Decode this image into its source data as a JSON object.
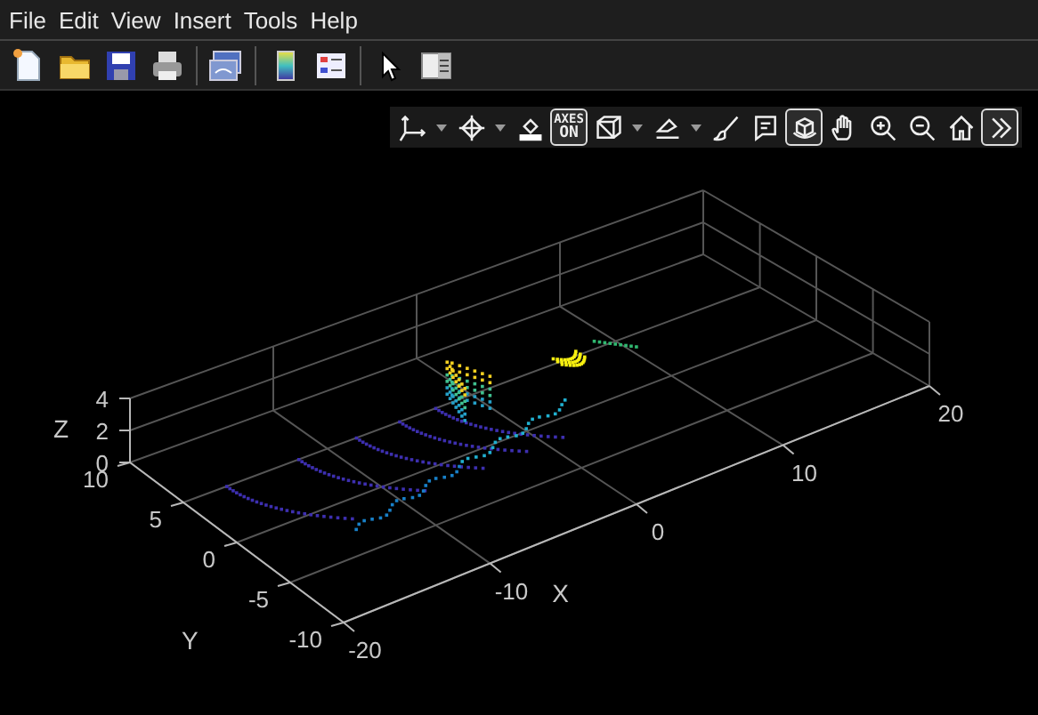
{
  "menu": [
    "File",
    "Edit",
    "View",
    "Insert",
    "Tools",
    "Help"
  ],
  "toolbar": [
    {
      "kind": "new"
    },
    {
      "kind": "open"
    },
    {
      "kind": "save"
    },
    {
      "kind": "print"
    },
    {
      "kind": "sep"
    },
    {
      "kind": "link"
    },
    {
      "kind": "sep"
    },
    {
      "kind": "colorbar"
    },
    {
      "kind": "legend"
    },
    {
      "kind": "sep"
    },
    {
      "kind": "pointer"
    },
    {
      "kind": "panel"
    }
  ],
  "axes_toolbar": [
    {
      "kind": "axes",
      "selected": false
    },
    {
      "kind": "caret"
    },
    {
      "kind": "cursor",
      "selected": false
    },
    {
      "kind": "caret"
    },
    {
      "kind": "fill",
      "selected": false
    },
    {
      "kind": "label",
      "label": "AXES",
      "label2": "ON",
      "selected": true
    },
    {
      "kind": "cube",
      "selected": false
    },
    {
      "kind": "caret"
    },
    {
      "kind": "eraser",
      "selected": false
    },
    {
      "kind": "caret"
    },
    {
      "kind": "brush",
      "selected": false
    },
    {
      "kind": "note",
      "selected": false
    },
    {
      "kind": "rotate",
      "selected": true
    },
    {
      "kind": "hand",
      "selected": false
    },
    {
      "kind": "zoomin",
      "selected": false
    },
    {
      "kind": "zoomout",
      "selected": false
    },
    {
      "kind": "home",
      "selected": false
    },
    {
      "kind": "more",
      "selected": true
    }
  ],
  "axes": {
    "xlabel": "X",
    "ylabel": "Y",
    "zlabel": "Z",
    "xticks": [
      "-20",
      "-10",
      "0",
      "10",
      "20"
    ],
    "yticks": [
      "10",
      "5",
      "0",
      "-5",
      "-10"
    ],
    "zticks": [
      "4",
      "2",
      "0"
    ]
  }
}
